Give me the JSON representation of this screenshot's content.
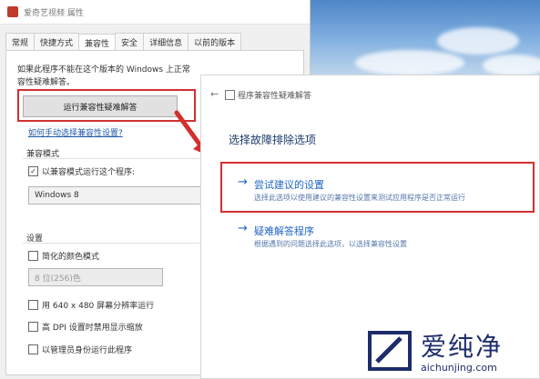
{
  "props_dialog": {
    "title": "爱奇艺视频 属性",
    "tabs": [
      "常规",
      "快捷方式",
      "兼容性",
      "安全",
      "详细信息",
      "以前的版本"
    ],
    "active_tab": "兼容性",
    "intro_text_1": "如果此程序不能在这个版本的 Windows 上正常",
    "intro_text_2": "容性疑难解答。",
    "troubleshoot_button": "运行兼容性疑难解答",
    "manual_link": "如何手动选择兼容性设置?",
    "compat_mode": {
      "title": "兼容模式",
      "checkbox_label": "以兼容模式运行这个程序:",
      "checked": true,
      "selected_os": "Windows 8"
    },
    "settings": {
      "title": "设置",
      "reduced_color": "简化的颜色模式",
      "color_select": "8 位(256)色",
      "res_640": "用 640 x 480 屏幕分辨率运行",
      "high_dpi": "高 DPI 设置时禁用显示缩放",
      "run_admin": "以管理员身份运行此程序"
    }
  },
  "troubleshooter": {
    "title": "程序兼容性疑难解答",
    "heading": "选择故障排除选项",
    "options": [
      {
        "title": "尝试建议的设置",
        "desc": "选择此选项以使用建议的兼容性设置来测试应用程序是否正常运行"
      },
      {
        "title": "疑难解答程序",
        "desc": "根据遇到的问题选择此选项，以选择兼容性设置"
      }
    ]
  },
  "watermark": {
    "brand": "爱纯净",
    "url": "aichunjing.com"
  },
  "colors": {
    "highlight": "#d32f2f",
    "link": "#1f66c5"
  }
}
